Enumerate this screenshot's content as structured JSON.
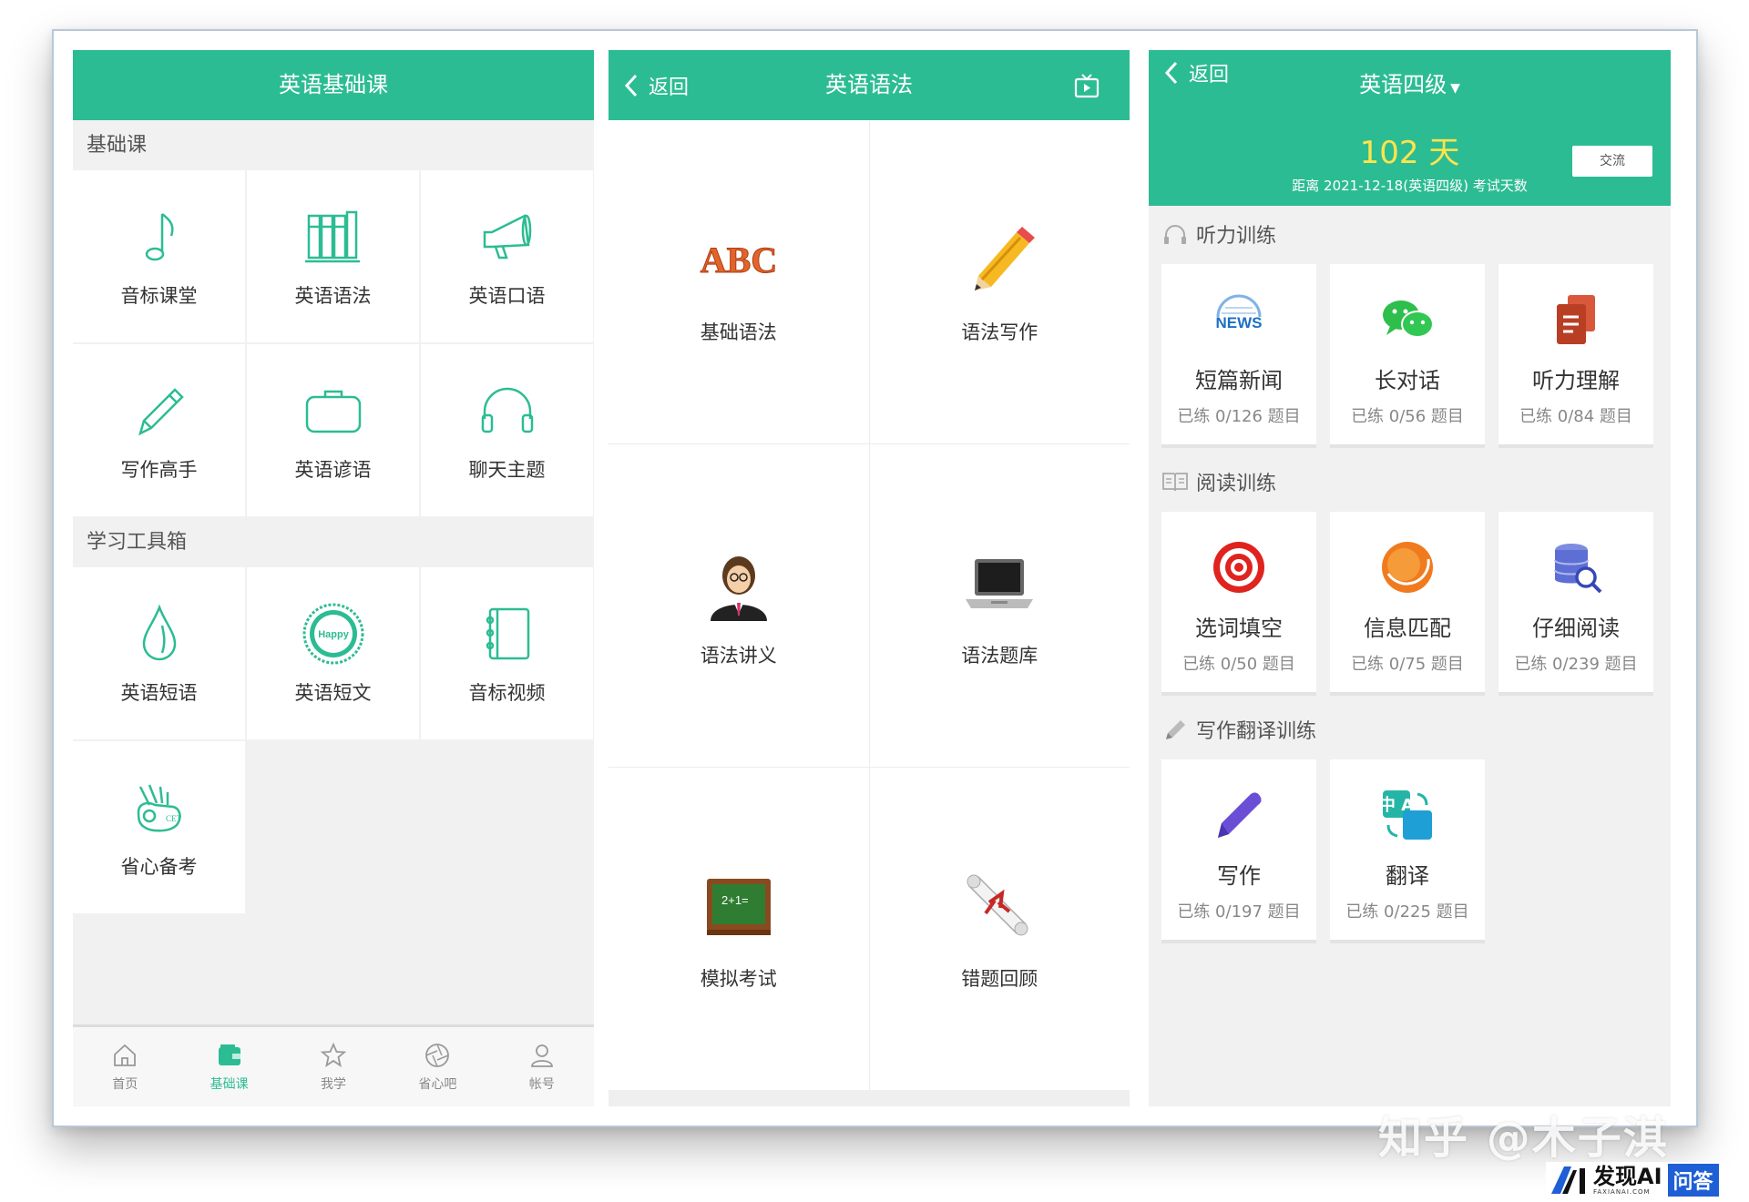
{
  "panel1": {
    "title": "英语基础课",
    "section1": "基础课",
    "grid1": [
      {
        "label": "音标课堂",
        "icon": "music-note-icon"
      },
      {
        "label": "英语语法",
        "icon": "books-icon"
      },
      {
        "label": "英语口语",
        "icon": "megaphone-icon"
      },
      {
        "label": "写作高手",
        "icon": "pencil-icon"
      },
      {
        "label": "英语谚语",
        "icon": "briefcase-icon"
      },
      {
        "label": "聊天主题",
        "icon": "headphones-icon"
      }
    ],
    "section2": "学习工具箱",
    "grid2": [
      {
        "label": "英语短语",
        "icon": "water-drop-icon"
      },
      {
        "label": "英语短文",
        "icon": "happy-badge-icon",
        "badge_text": "Happy"
      },
      {
        "label": "音标视频",
        "icon": "notebook-icon"
      },
      {
        "label": "省心备考",
        "icon": "ok-hand-icon",
        "badge_text": "CET"
      }
    ],
    "tabs": [
      {
        "label": "首页",
        "icon": "home-icon"
      },
      {
        "label": "基础课",
        "icon": "wallet-icon",
        "active": true
      },
      {
        "label": "我学",
        "icon": "star-icon"
      },
      {
        "label": "省心吧",
        "icon": "aperture-icon"
      },
      {
        "label": "帐号",
        "icon": "user-icon"
      }
    ],
    "accent": "#2cbc93"
  },
  "panel2": {
    "back_label": "返回",
    "title": "英语语法",
    "grid": [
      {
        "label": "基础语法",
        "icon": "abc-icon",
        "icon_text": "ABC"
      },
      {
        "label": "语法写作",
        "icon": "pencil-icon"
      },
      {
        "label": "语法讲义",
        "icon": "teacher-icon"
      },
      {
        "label": "语法题库",
        "icon": "laptop-icon"
      },
      {
        "label": "模拟考试",
        "icon": "chalkboard-icon",
        "icon_text": "2+1="
      },
      {
        "label": "错题回顾",
        "icon": "scroll-icon"
      }
    ]
  },
  "panel3": {
    "back_label": "返回",
    "title": "英语四级",
    "days": "102 天",
    "subtitle": "距离 2021-12-18(英语四级) 考试天数",
    "exchange_label": "交流",
    "sections": [
      {
        "label": "听力训练",
        "icon": "headphones-icon",
        "cards": [
          {
            "name": "短篇新闻",
            "count": "已练 0/126 题目",
            "icon": "news-icon",
            "icon_text": "NEWS"
          },
          {
            "name": "长对话",
            "count": "已练 0/56 题目",
            "icon": "chat-bubbles-icon"
          },
          {
            "name": "听力理解",
            "count": "已练 0/84 题目",
            "icon": "documents-icon"
          }
        ]
      },
      {
        "label": "阅读训练",
        "icon": "open-book-icon",
        "cards": [
          {
            "name": "选词填空",
            "count": "已练 0/50 题目",
            "icon": "target-icon"
          },
          {
            "name": "信息匹配",
            "count": "已练 0/75 题目",
            "icon": "orange-circle-icon"
          },
          {
            "name": "仔细阅读",
            "count": "已练 0/239 题目",
            "icon": "database-search-icon"
          }
        ]
      },
      {
        "label": "写作翻译训练",
        "icon": "pen-icon",
        "cards": [
          {
            "name": "写作",
            "count": "已练 0/197 题目",
            "icon": "purple-pen-icon"
          },
          {
            "name": "翻译",
            "count": "已练 0/225 题目",
            "icon": "translate-icon",
            "icon_text": "中 A"
          }
        ]
      }
    ]
  },
  "watermark": {
    "text": "知乎 @木子淇",
    "brand": "发现AI",
    "brand_tag": "问答",
    "brand_sub": "FAXIANAI.COM"
  }
}
